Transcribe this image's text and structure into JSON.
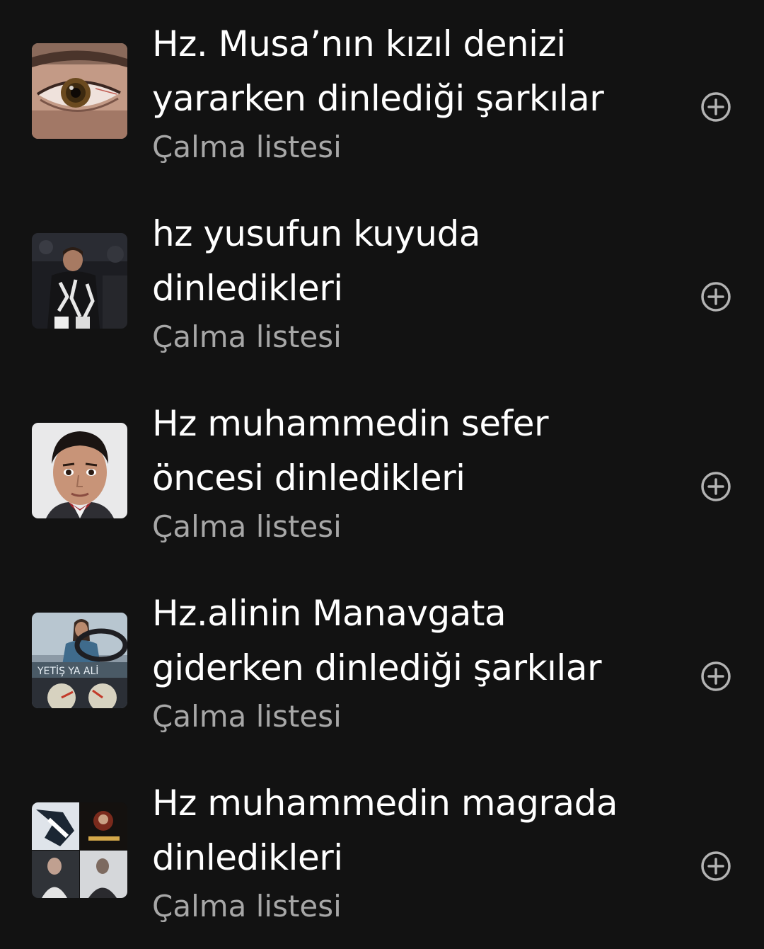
{
  "colors": {
    "background": "#121212",
    "title": "#ffffff",
    "subtitle": "#a7a7a7",
    "icon": "#b3b3b3"
  },
  "playlists": [
    {
      "title_line1": "Hz. Musa’nın kızıl denizi",
      "title_line2": "yararken dinlediği şarkılar",
      "subtitle": "Çalma listesi",
      "cover_icon": "eye-closeup-cover",
      "action_icon": "add-circle-icon"
    },
    {
      "title_line1": "hz yusufun kuyuda",
      "title_line2": "dinledikleri",
      "subtitle": "Çalma listesi",
      "cover_icon": "boy-in-jacket-cover",
      "action_icon": "add-circle-icon"
    },
    {
      "title_line1": "Hz muhammedin sefer",
      "title_line2": "öncesi dinledikleri",
      "subtitle": "Çalma listesi",
      "cover_icon": "boy-portrait-cover",
      "action_icon": "add-circle-icon"
    },
    {
      "title_line1": "Hz.alinin Manavgata",
      "title_line2": "giderken dinlediği şarkılar",
      "subtitle": "Çalma listesi",
      "cover_icon": "driver-car-cover",
      "cover_text": "YETİŞ YA ALİ",
      "action_icon": "add-circle-icon"
    },
    {
      "title_line1": "Hz muhammedin magrada",
      "title_line2": "dinledikleri",
      "subtitle": "Çalma listesi",
      "cover_icon": "photo-collage-cover",
      "action_icon": "add-circle-icon"
    }
  ]
}
